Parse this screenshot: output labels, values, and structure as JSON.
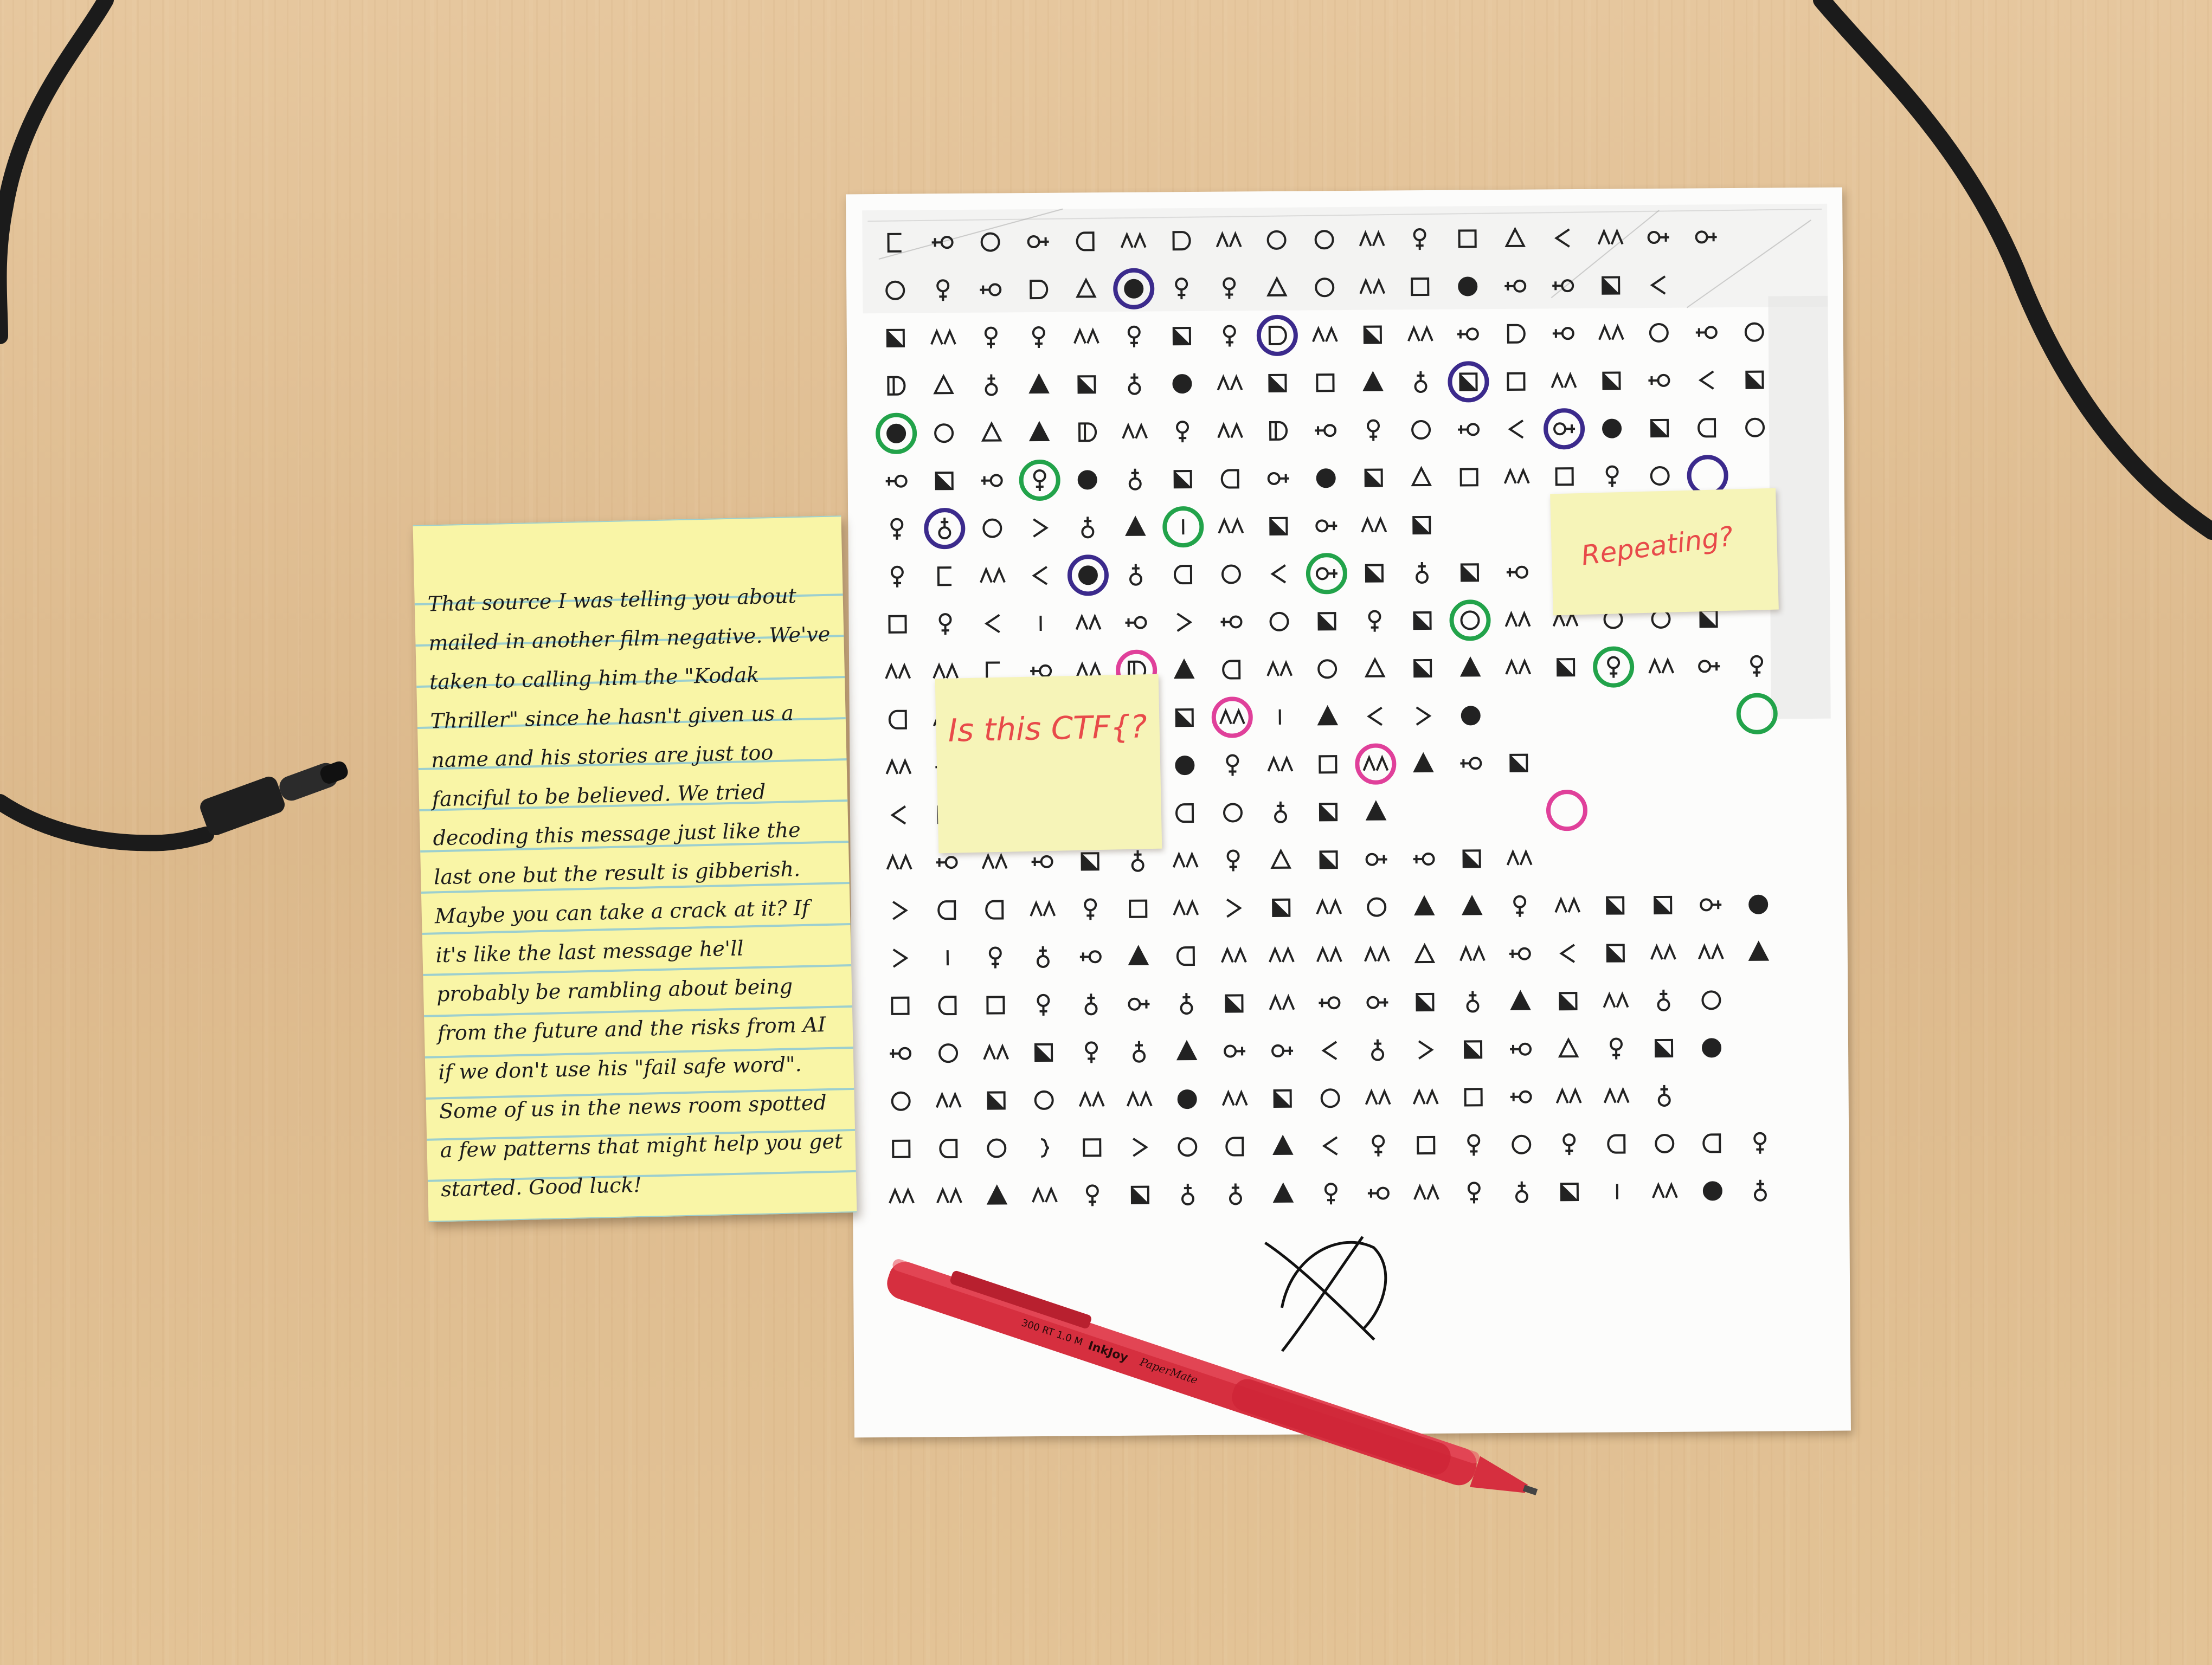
{
  "sticky_note": {
    "text": "That source I was telling you about mailed in another film negative. We've taken to calling him the \"Kodak Thriller\" since he hasn't given us a name and his stories are just too fanciful to be believed. We tried decoding this message just like the last one but the result is gibberish. Maybe you can take a crack at it? If it's like the last message he'll probably be rambling about being from the future and the risks from AI if we don't use his \"fail safe word\". Some of us in the news room spotted a few patterns that might help you get started. Good luck!"
  },
  "note_ctf": {
    "text": "Is this CTF{?"
  },
  "note_repeating": {
    "text": "Repeating?"
  },
  "pen": {
    "brand": "InkJoy",
    "maker": "PaperMate",
    "imprint": "300 RT  1.0 M"
  },
  "cipher": {
    "rows": [
      [
        "q",
        "h",
        "o",
        "k",
        "p",
        "m",
        "d",
        "m",
        "o",
        "o",
        "m",
        "g",
        "s",
        "t",
        "<",
        "m",
        "k",
        "k"
      ],
      [
        "o",
        "g",
        "h",
        "d",
        "t",
        "F",
        "g",
        "g",
        "t",
        "o",
        "m",
        "s",
        "F",
        "h",
        "h",
        "Q",
        "<"
      ],
      [
        "Q",
        "m",
        "g",
        "g",
        "m",
        "g",
        "Q",
        "g",
        "d",
        "m",
        "Q",
        "m",
        "h",
        "d",
        "h",
        "m",
        "o",
        "h",
        "o"
      ],
      [
        "D",
        "t",
        "b",
        "T",
        "Q",
        "b",
        "F",
        "m",
        "Q",
        "s",
        "T",
        "b",
        "Q",
        "s",
        "m",
        "Q",
        "h",
        "<",
        "Q"
      ],
      [
        "F",
        "o",
        "t",
        "T",
        "D",
        "m",
        "g",
        "m",
        "D",
        "h",
        "g",
        "o",
        "h",
        "<",
        "k",
        "F",
        "Q",
        "p",
        "o"
      ],
      [
        "h",
        "Q",
        "h",
        "g",
        "F",
        "b",
        "Q",
        "p",
        "k",
        "F",
        "Q",
        "t",
        "s",
        "m",
        "s",
        "g",
        "o"
      ],
      [
        "g",
        "b",
        "o",
        ">",
        "b",
        "T",
        "i",
        "m",
        "Q",
        "k",
        "m",
        "Q"
      ],
      [
        "g",
        "q",
        "m",
        "<",
        "F",
        "b",
        "p",
        "o",
        "<",
        "k",
        "Q",
        "b",
        "Q",
        "h",
        "p"
      ],
      [
        "s",
        "g",
        "<",
        "i",
        "m",
        "h",
        ">",
        "h",
        "o",
        "Q",
        "g",
        "Q",
        "o",
        "m",
        "m",
        "o",
        "o",
        "Q"
      ],
      [
        "m",
        "m",
        "q",
        "h",
        "m",
        "D",
        "T",
        "p",
        "m",
        "o",
        "t",
        "Q",
        "T",
        "m",
        "Q",
        "g",
        "m",
        "k",
        "g"
      ],
      [
        "p",
        "m",
        "b",
        "m",
        "h",
        "h",
        "Q",
        "m",
        "i",
        "T",
        "<",
        ">",
        "F"
      ],
      [
        "m",
        "h",
        "g",
        "t",
        "m",
        "h",
        "F",
        "g",
        "m",
        "s",
        "m",
        "T",
        "h",
        "Q"
      ],
      [
        "<",
        "s",
        ">",
        "p",
        "o",
        "b",
        "p",
        "o",
        "b",
        "Q",
        "T"
      ],
      [
        "m",
        "h",
        "m",
        "h",
        "Q",
        "b",
        "m",
        "g",
        "t",
        "Q",
        "k",
        "h",
        "Q",
        "m"
      ],
      [
        ">",
        "p",
        "p",
        "m",
        "g",
        "s",
        "m",
        ">",
        "Q",
        "m",
        "o",
        "T",
        "T",
        "g",
        "m",
        "Q",
        "Q",
        "k",
        "F"
      ],
      [
        ">",
        "i",
        "g",
        "b",
        "h",
        "T",
        "p",
        "m",
        "m",
        "m",
        "m",
        "t",
        "m",
        "h",
        "<",
        "Q",
        "m",
        "m",
        "T"
      ],
      [
        "s",
        "p",
        "s",
        "g",
        "b",
        "k",
        "b",
        "Q",
        "m",
        "h",
        "k",
        "Q",
        "b",
        "T",
        "Q",
        "m",
        "b",
        "o"
      ],
      [
        "h",
        "o",
        "m",
        "Q",
        "g",
        "b",
        "T",
        "k",
        "k",
        "<",
        "b",
        ">",
        "Q",
        "h",
        "t",
        "g",
        "Q",
        "F"
      ],
      [
        "o",
        "m",
        "Q",
        "o",
        "m",
        "m",
        "F",
        "m",
        "Q",
        "o",
        "m",
        "m",
        "s",
        "h",
        "m",
        "m",
        "b"
      ],
      [
        "s",
        "p",
        "o",
        "}",
        "s",
        ">",
        "o",
        "p",
        "T",
        "<",
        "g",
        "s",
        "g",
        "o",
        "g",
        "p",
        "o",
        "p",
        "g"
      ],
      [
        "m",
        "m",
        "T",
        "m",
        "g",
        "Q",
        "b",
        "b",
        "T",
        "g",
        "h",
        "m",
        "g",
        "b",
        "Q",
        "i",
        "m",
        "F",
        "b"
      ]
    ],
    "circles": [
      {
        "r": 1,
        "c": 5,
        "color": "#3b2a8c"
      },
      {
        "r": 2,
        "c": 8,
        "color": "#3b2a8c"
      },
      {
        "r": 3,
        "c": 12,
        "color": "#3b2a8c"
      },
      {
        "r": 4,
        "c": 14,
        "color": "#3b2a8c"
      },
      {
        "r": 6,
        "c": 1,
        "color": "#3b2a8c"
      },
      {
        "r": 7,
        "c": 4,
        "color": "#3b2a8c"
      },
      {
        "r": 4,
        "c": 0,
        "color": "#22a34a"
      },
      {
        "r": 5,
        "c": 3,
        "color": "#22a34a"
      },
      {
        "r": 5,
        "c": 17,
        "color": "#3b2a8c"
      },
      {
        "r": 6,
        "c": 6,
        "color": "#22a34a"
      },
      {
        "r": 7,
        "c": 9,
        "color": "#22a34a"
      },
      {
        "r": 8,
        "c": 12,
        "color": "#22a34a"
      },
      {
        "r": 9,
        "c": 15,
        "color": "#22a34a"
      },
      {
        "r": 10,
        "c": 18,
        "color": "#22a34a"
      },
      {
        "r": 9,
        "c": 5,
        "color": "#e0409a"
      },
      {
        "r": 10,
        "c": 7,
        "color": "#e0409a"
      },
      {
        "r": 11,
        "c": 10,
        "color": "#e0409a"
      },
      {
        "r": 12,
        "c": 14,
        "color": "#e0409a"
      }
    ]
  }
}
